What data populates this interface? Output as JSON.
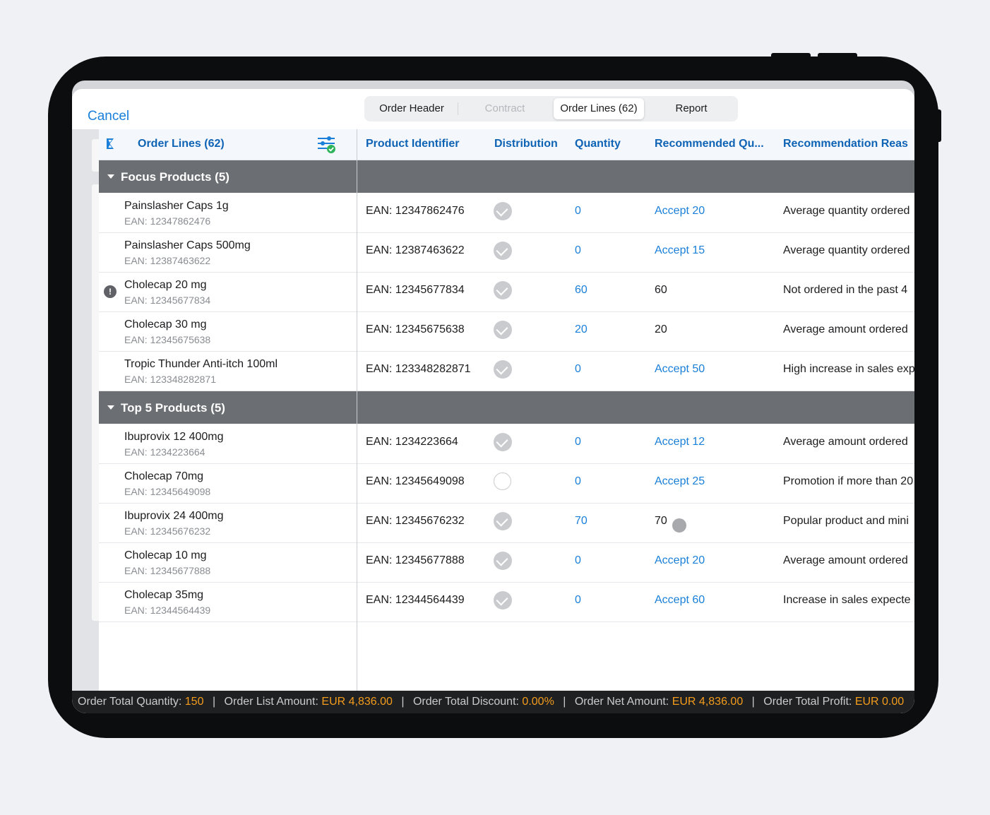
{
  "header": {
    "cancel_label": "Cancel",
    "tabs": [
      {
        "label": "Order Header",
        "state": "normal"
      },
      {
        "label": "Contract",
        "state": "disabled"
      },
      {
        "label": "Order Lines (62)",
        "state": "active"
      },
      {
        "label": "Report",
        "state": "normal"
      }
    ]
  },
  "table": {
    "left_header": "Order Lines (62)",
    "columns": [
      "Product Identifier",
      "Distribution",
      "Quantity",
      "Recommended Qu...",
      "Recommendation Reas"
    ],
    "groups": [
      {
        "label": "Focus Products (5)",
        "rows": [
          {
            "name": "Painslasher Caps 1g",
            "ean_sub": "EAN: 12347862476",
            "identifier": "EAN: 12347862476",
            "distribution": true,
            "quantity": "0",
            "recommended": "Accept 20",
            "recommended_link": true,
            "reason": "Average quantity ordered"
          },
          {
            "name": "Painslasher Caps 500mg",
            "ean_sub": "EAN: 12387463622",
            "identifier": "EAN: 12387463622",
            "distribution": true,
            "quantity": "0",
            "recommended": "Accept 15",
            "recommended_link": true,
            "reason": "Average quantity ordered"
          },
          {
            "name": "Cholecap 20 mg",
            "ean_sub": "EAN: 12345677834",
            "identifier": "EAN: 12345677834",
            "distribution": true,
            "quantity": "60",
            "recommended": "60",
            "recommended_link": false,
            "reason": "Not ordered in the past 4",
            "warning": true
          },
          {
            "name": "Cholecap 30 mg",
            "ean_sub": "EAN: 12345675638",
            "identifier": "EAN: 12345675638",
            "distribution": true,
            "quantity": "20",
            "recommended": "20",
            "recommended_link": false,
            "reason": "Average amount ordered"
          },
          {
            "name": "Tropic Thunder Anti-itch 100ml",
            "ean_sub": "EAN: 123348282871",
            "identifier": "EAN: 123348282871",
            "distribution": true,
            "quantity": "0",
            "recommended": "Accept 50",
            "recommended_link": true,
            "reason": "High increase in sales exp"
          }
        ]
      },
      {
        "label": "Top 5 Products (5)",
        "rows": [
          {
            "name": "Ibuprovix 12 400mg",
            "ean_sub": "EAN: 1234223664",
            "identifier": "EAN: 1234223664",
            "distribution": true,
            "quantity": "0",
            "recommended": "Accept 12",
            "recommended_link": true,
            "reason": "Average amount ordered"
          },
          {
            "name": "Cholecap 70mg",
            "ean_sub": "EAN: 12345649098",
            "identifier": "EAN: 12345649098",
            "distribution": false,
            "quantity": "0",
            "recommended": "Accept 25",
            "recommended_link": true,
            "reason": "Promotion if more than 20"
          },
          {
            "name": "Ibuprovix 24 400mg",
            "ean_sub": "EAN: 12345676232",
            "identifier": "EAN: 12345676232",
            "distribution": true,
            "quantity": "70",
            "recommended": "70",
            "recommended_link": false,
            "reason": "Popular product and mini",
            "touch": true
          },
          {
            "name": "Cholecap 10 mg",
            "ean_sub": "EAN: 12345677888",
            "identifier": "EAN: 12345677888",
            "distribution": true,
            "quantity": "0",
            "recommended": "Accept 20",
            "recommended_link": true,
            "reason": "Average amount ordered"
          },
          {
            "name": "Cholecap 35mg",
            "ean_sub": "EAN: 12344564439",
            "identifier": "EAN: 12344564439",
            "distribution": true,
            "quantity": "0",
            "recommended": "Accept 60",
            "recommended_link": true,
            "reason": "Increase in sales expecte"
          }
        ]
      }
    ]
  },
  "footer": {
    "total_quantity_label": "Order Total Quantity:",
    "total_quantity": "150",
    "list_amount_label": "Order List Amount:",
    "list_amount": "EUR 4,836.00",
    "discount_label": "Order Total Discount:",
    "discount": "0.00%",
    "net_amount_label": "Order Net Amount:",
    "net_amount": "EUR 4,836.00",
    "profit_label": "Order Total Profit:",
    "profit": "EUR 0.00"
  },
  "colors": {
    "accent": "#1a7fd9",
    "header_text": "#0f63b5",
    "group_bg": "#6b6e72",
    "footer_value": "#f39b1c"
  },
  "icons": {
    "sum": "sigma-icon",
    "filter": "filter-settings-icon",
    "group_toggle": "caret-down-icon",
    "distribution": "check-circle-icon",
    "warning": "warning-icon"
  }
}
